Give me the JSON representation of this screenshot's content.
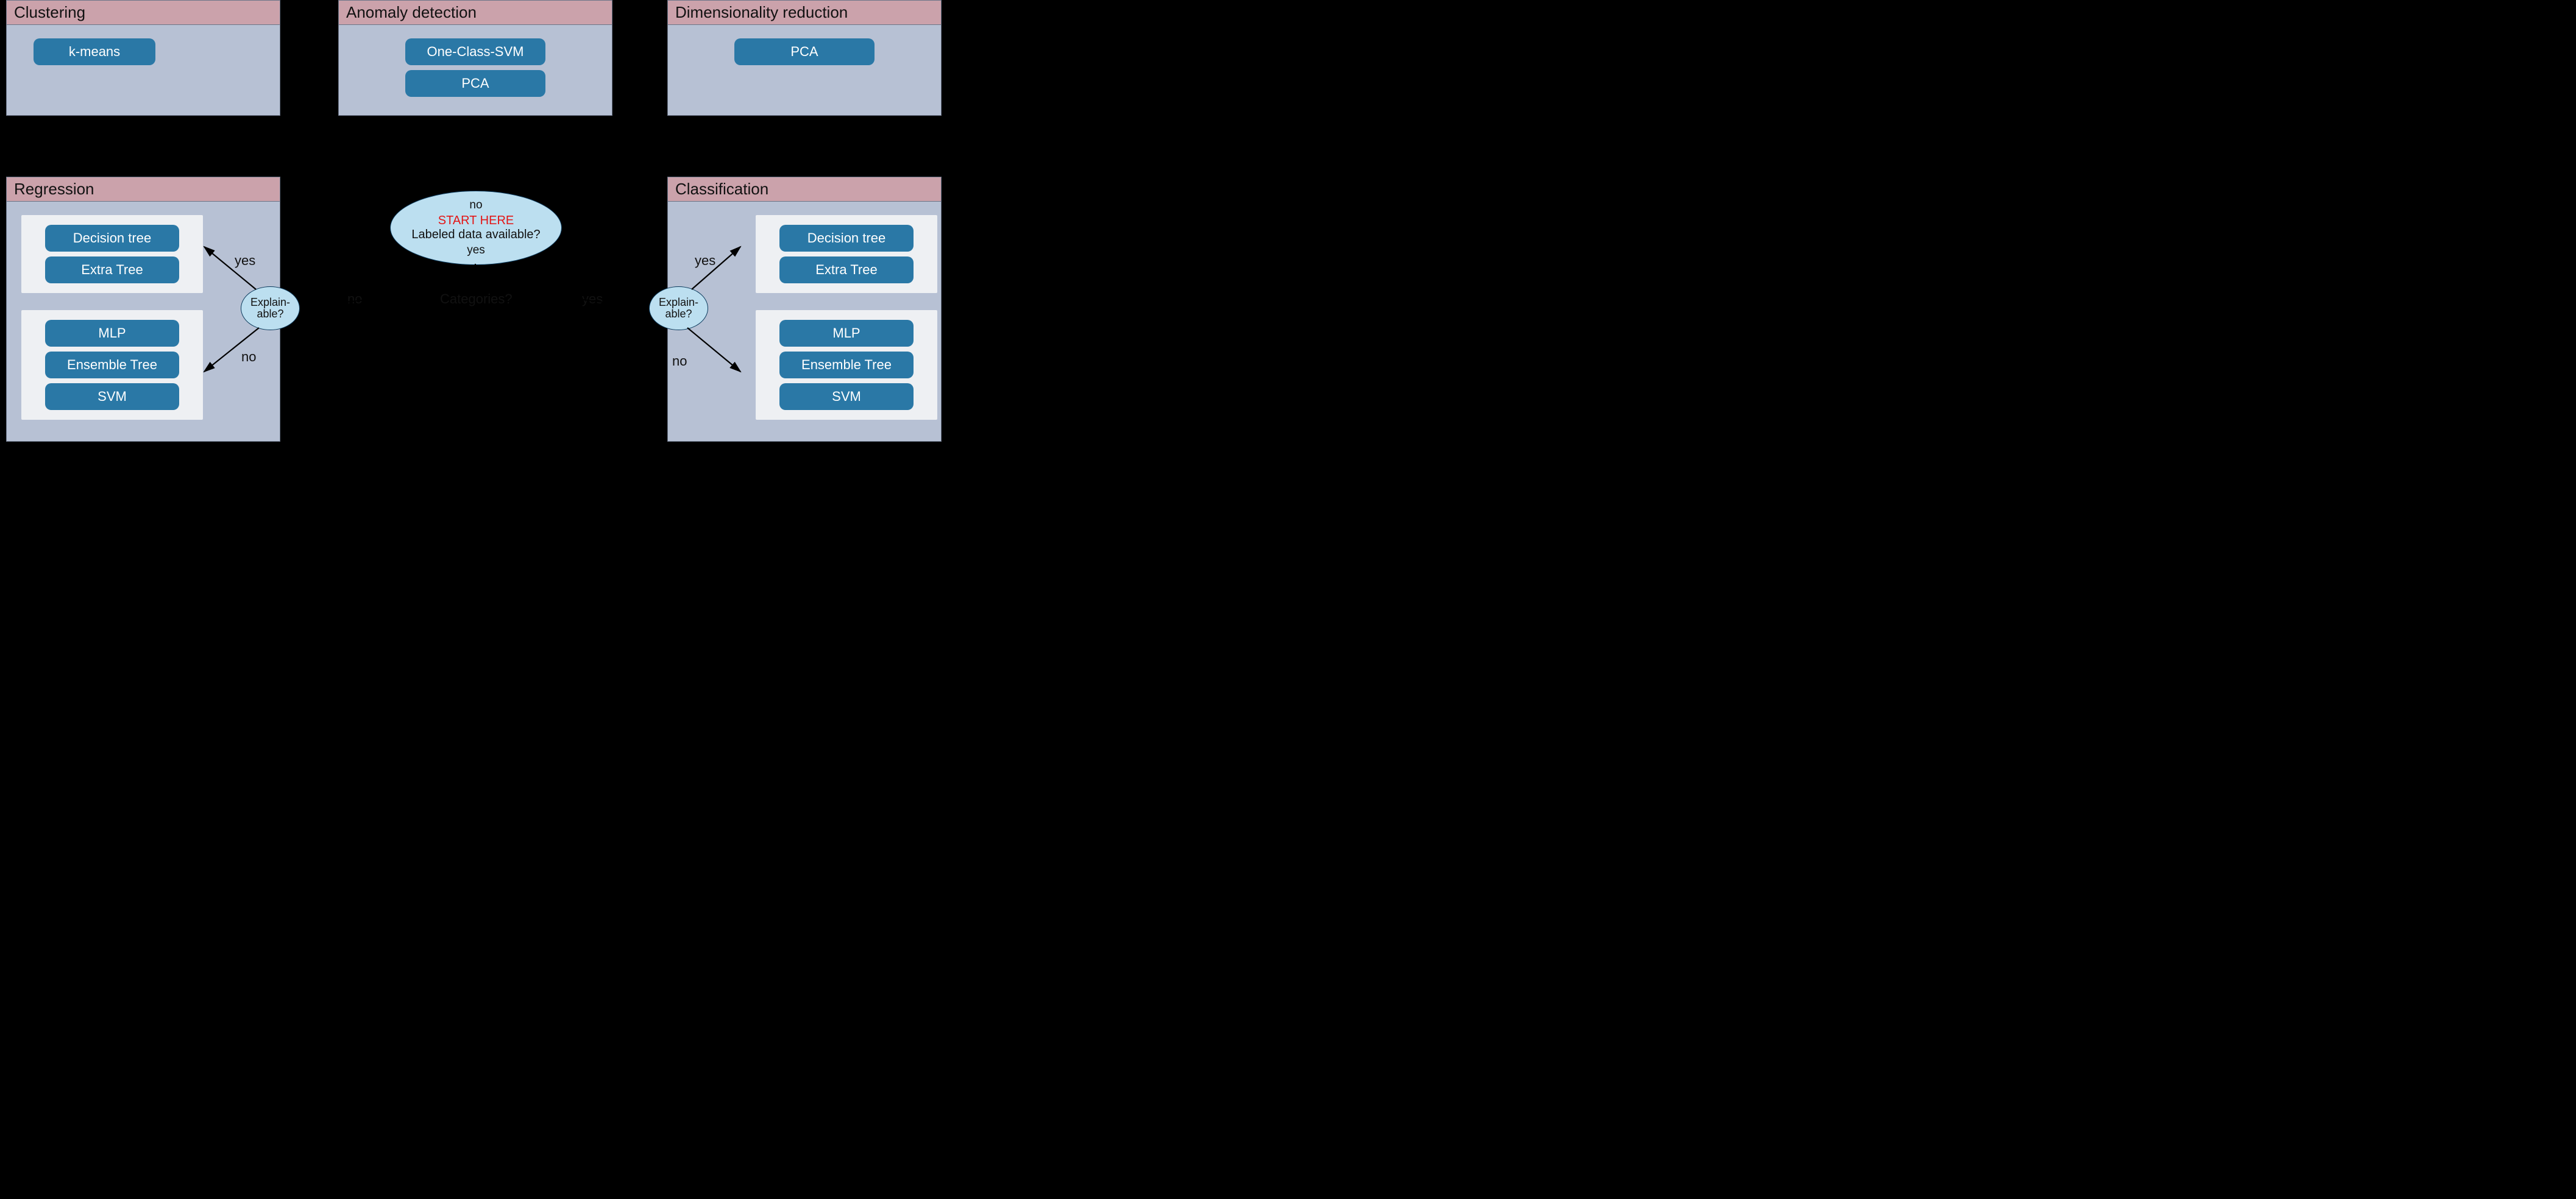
{
  "panels": {
    "clustering": {
      "title": "Clustering",
      "algos": [
        "k-means"
      ]
    },
    "anomaly": {
      "title": "Anomaly detection",
      "algos": [
        "One-Class-SVM",
        "PCA"
      ]
    },
    "dimred": {
      "title": "Dimensionality reduction",
      "algos": [
        "PCA"
      ]
    },
    "regression": {
      "title": "Regression",
      "group_yes": [
        "Decision tree",
        "Extra Tree"
      ],
      "group_no": [
        "MLP",
        "Ensemble Tree",
        "SVM"
      ]
    },
    "classification": {
      "title": "Classification",
      "group_yes": [
        "Decision tree",
        "Extra Tree"
      ],
      "group_no": [
        "MLP",
        "Ensemble Tree",
        "SVM"
      ]
    }
  },
  "decisions": {
    "start": {
      "highlight": "START HERE",
      "question": "Labeled data available?",
      "top": "no",
      "bottom": "yes"
    },
    "left": {
      "question_l1": "Explain-",
      "question_l2": "able?",
      "yes": "yes",
      "no": "no"
    },
    "right": {
      "question_l1": "Explain-",
      "question_l2": "able?",
      "yes": "yes",
      "no": "no"
    },
    "midQ": {
      "q": "Categories?",
      "yes": "yes",
      "no": "no"
    }
  }
}
